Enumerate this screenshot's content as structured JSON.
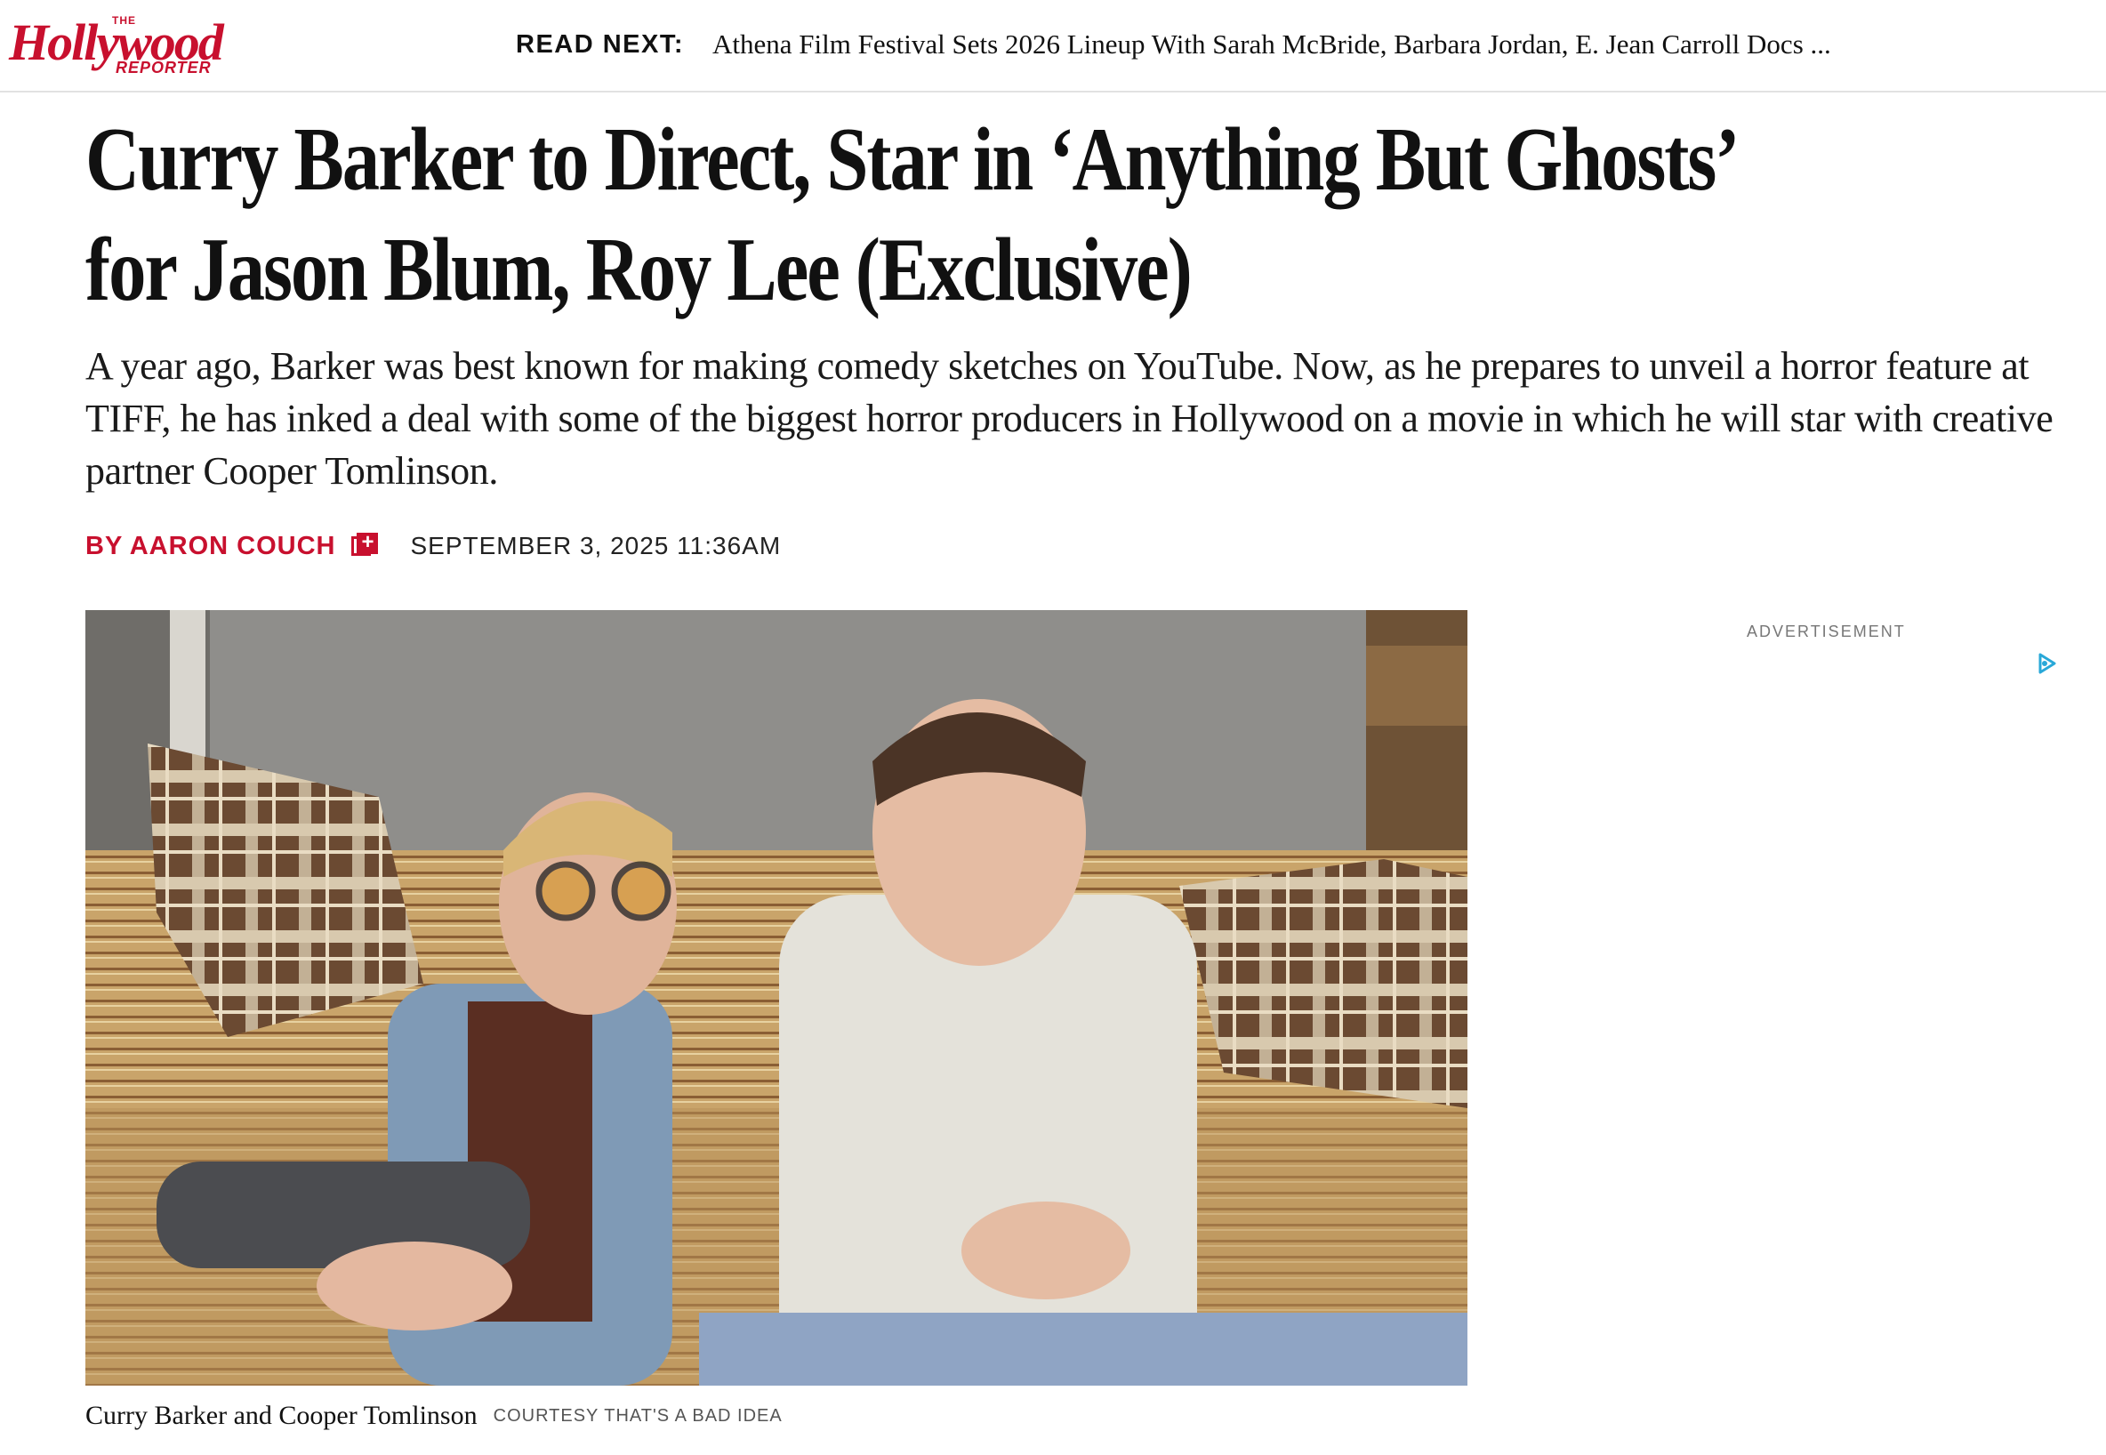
{
  "site": {
    "logo_top": "THE",
    "logo_word": "Hollywood",
    "logo_bottom": "REPORTER",
    "brand_color": "#c8102e"
  },
  "read_next": {
    "label": "READ NEXT:",
    "link": "Athena Film Festival Sets 2026 Lineup With Sarah McBride, Barbara Jordan, E. Jean Carroll Docs ..."
  },
  "article": {
    "headline": "Curry Barker to Direct, Star in ‘Anything But Ghosts’ for Jason Blum, Roy Lee (Exclusive)",
    "deck": "A year ago, Barker was best known for making comedy sketches on YouTube. Now, as he prepares to unveil a horror feature at TIFF, he has inked a deal with some of the biggest horror producers in Hollywood on a movie in which he will star with creative partner Cooper Tomlinson.",
    "byline": "BY AARON COUCH",
    "follow_icon": "follow-plus-icon",
    "date": "SEPTEMBER 3, 2025 11:36AM",
    "image_caption": "Curry Barker and Cooper Tomlinson",
    "image_credit": "COURTESY THAT'S A BAD IDEA"
  },
  "sidebar": {
    "ad_label": "ADVERTISEMENT",
    "ad_icon": "adchoices-icon"
  }
}
